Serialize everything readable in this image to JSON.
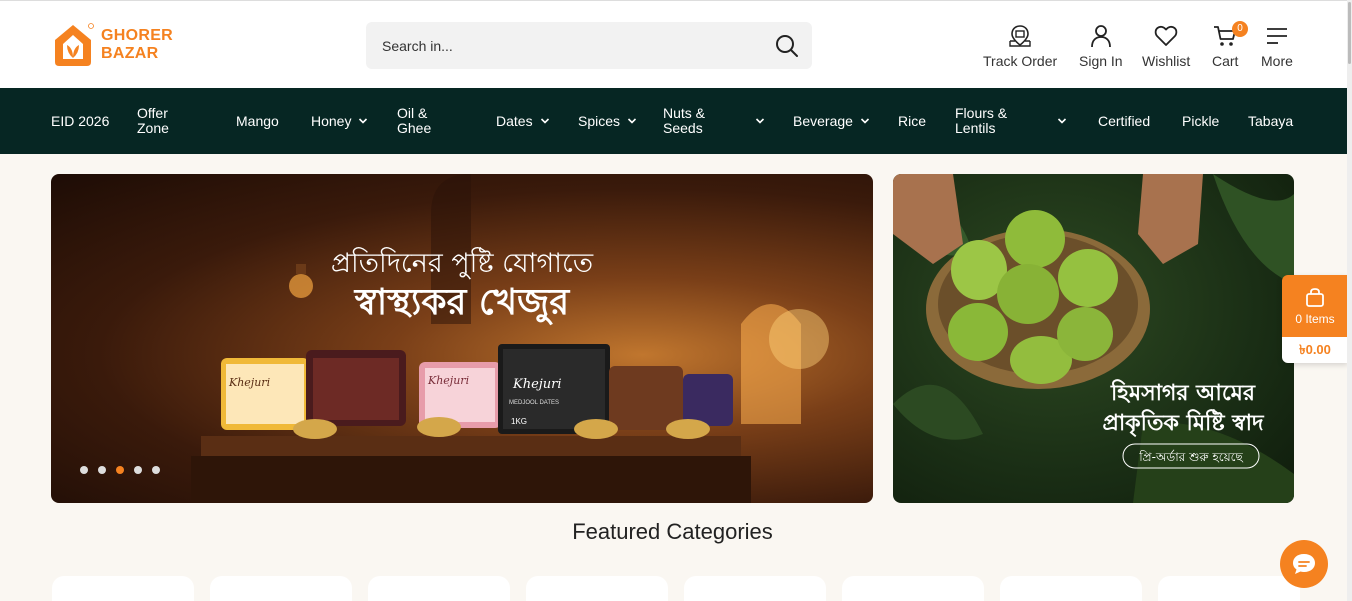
{
  "header": {
    "logo_line1": "GHORER",
    "logo_line2": "BAZAR",
    "search_placeholder": "Search in...",
    "actions": [
      {
        "label": "Track Order",
        "icon": "track-order-icon"
      },
      {
        "label": "Sign In",
        "icon": "user-icon"
      },
      {
        "label": "Wishlist",
        "icon": "heart-icon"
      },
      {
        "label": "Cart",
        "icon": "cart-icon",
        "badge": "0"
      },
      {
        "label": "More",
        "icon": "menu-icon"
      }
    ]
  },
  "nav": {
    "items": [
      {
        "label": "EID 2026",
        "dropdown": false
      },
      {
        "label": "Offer Zone",
        "dropdown": false
      },
      {
        "label": "Mango",
        "dropdown": false
      },
      {
        "label": "Honey",
        "dropdown": true
      },
      {
        "label": "Oil & Ghee",
        "dropdown": false
      },
      {
        "label": "Dates",
        "dropdown": true
      },
      {
        "label": "Spices",
        "dropdown": true
      },
      {
        "label": "Nuts & Seeds",
        "dropdown": true
      },
      {
        "label": "Beverage",
        "dropdown": true
      },
      {
        "label": "Rice",
        "dropdown": false
      },
      {
        "label": "Flours & Lentils",
        "dropdown": true
      },
      {
        "label": "Certified",
        "dropdown": false
      },
      {
        "label": "Pickle",
        "dropdown": false
      },
      {
        "label": "Tabaya",
        "dropdown": false
      }
    ]
  },
  "hero": {
    "main_line1": "প্রতিদিনের পুষ্টি যোগাতে",
    "main_line2": "স্বাস্থ্যকর খেজুর",
    "product_brand": "Khejuri",
    "product_name": "MEDJOOL DATES",
    "product_weight": "1KG",
    "slide_count": 5,
    "active_slide": 3,
    "side_line1": "হিমসাগর আমের",
    "side_line2": "প্রাকৃতিক মিষ্টি স্বাদ",
    "side_tag": "প্রি-অর্ডার শুরু হয়েছে"
  },
  "featured": {
    "title": "Featured Categories"
  },
  "float_cart": {
    "items_label": "0 Items",
    "total": "৳0.00"
  },
  "colors": {
    "brand": "#f58220",
    "nav_bg": "#062623",
    "page_bg": "#faf7f2"
  }
}
